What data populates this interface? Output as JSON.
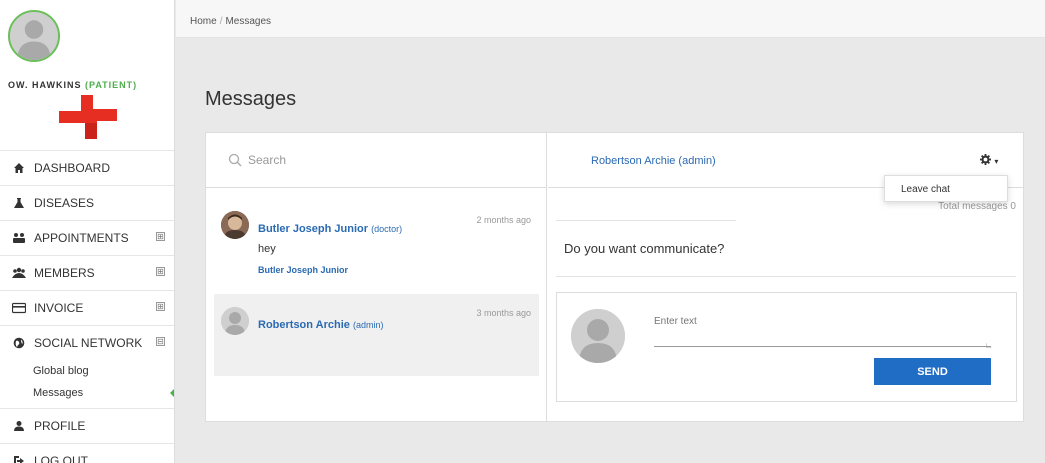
{
  "user": {
    "name": "OW. HAWKINS",
    "role": "(PATIENT)"
  },
  "nav": {
    "items": [
      {
        "label": "DASHBOARD",
        "icon": "home-icon"
      },
      {
        "label": "DISEASES",
        "icon": "flask-icon"
      },
      {
        "label": "APPOINTMENTS",
        "icon": "appointments-icon",
        "expand": "⊞"
      },
      {
        "label": "MEMBERS",
        "icon": "users-icon",
        "expand": "⊞"
      },
      {
        "label": "INVOICE",
        "icon": "credit-card-icon",
        "expand": "⊞"
      },
      {
        "label": "SOCIAL NETWORK",
        "icon": "globe-icon",
        "expand": "⊟"
      },
      {
        "label": "PROFILE",
        "icon": "user-icon"
      },
      {
        "label": "LOG OUT",
        "icon": "logout-icon"
      }
    ],
    "social_sub": [
      "Global blog",
      "Messages"
    ]
  },
  "breadcrumb": {
    "home": "Home",
    "sep": "/",
    "current": "Messages"
  },
  "page_title": "Messages",
  "search": {
    "placeholder": "Search"
  },
  "conversations": [
    {
      "name": "Butler Joseph Junior",
      "role": "(doctor)",
      "time": "2 months ago",
      "message": "hey",
      "sender": "Butler Joseph Junior"
    },
    {
      "name": "Robertson Archie",
      "role": "(admin)",
      "time": "3 months ago"
    }
  ],
  "chat": {
    "with": "Robertson Archie (admin)",
    "menu_item": "Leave chat",
    "total": "Total messages 0",
    "message": "Do you want communicate?",
    "input_placeholder": "Enter text",
    "send_label": "SEND"
  },
  "colors": {
    "accent": "#1f6dc5",
    "link": "#2a6ab3",
    "patient": "#4cae4c",
    "logo_red": "#e62f22"
  }
}
